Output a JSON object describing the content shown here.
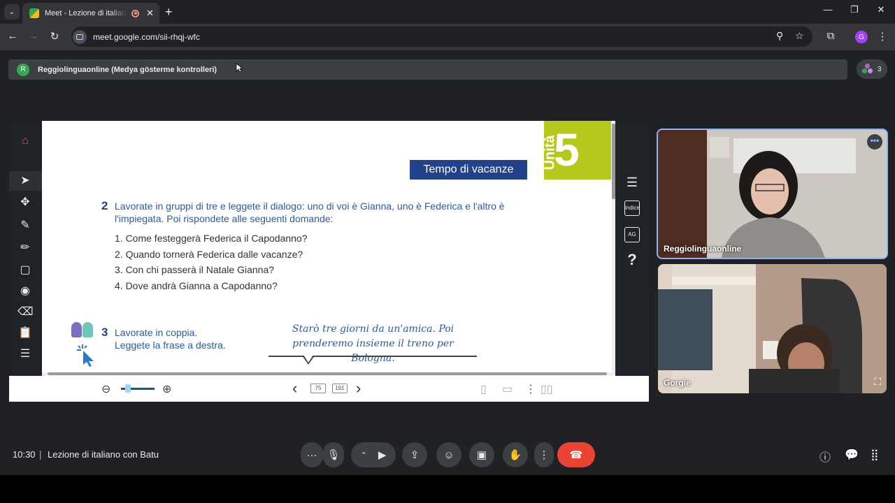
{
  "browser": {
    "tab_title": "Meet - Lezione di italiano c",
    "url": "meet.google.com/sii-rhqj-wfc",
    "profile_initial": "G"
  },
  "banner": {
    "presenter_initial": "R",
    "text": "Reggiolinguaonline (Medya gösterme kontrolleri)",
    "participants_count": "3"
  },
  "shared_page": {
    "unit_word": "Unità",
    "unit_number": "5",
    "unit_title": "Tempo di vacanze",
    "exercise2": {
      "number": "2",
      "text": "Lavorate in gruppi di tre e leggete il dialogo: uno di voi è Gianna, uno è Federica e l'altro è l'impiegata. Poi rispondete alle seguenti domande:"
    },
    "questions": [
      "1.  Come festeggerà Federica il Capodanno?",
      "2.  Quando tornerà Federica dalle vacanze?",
      "3.  Con chi passerà il Natale Gianna?",
      "4.  Dove andrà Gianna a Capodanno?"
    ],
    "exercise3": {
      "number": "3",
      "line1": "Lavorate in coppia.",
      "line2": "Leggete la frase a destra."
    },
    "handwritten": {
      "line1": "Starò tre giorni da un'amica. Poi",
      "line2": "prenderemo insieme il treno per Bologna."
    },
    "right_tools": {
      "index_label": "indice",
      "ag_label": "AG",
      "help": "?"
    },
    "bottom_bar": {
      "current_page": "75",
      "total_pages": "191",
      "zoom_level": 0.2
    }
  },
  "participants": [
    {
      "name": "Reggiolinguaonline"
    },
    {
      "name": "Gorgie"
    }
  ],
  "meeting": {
    "time": "10:30",
    "separator": "|",
    "title": "Lezione di italiano con Batu"
  },
  "colors": {
    "unit_green": "#b5c91b",
    "title_blue": "#22428e",
    "text_blue": "#2a5aa8",
    "end_call": "#ea4335",
    "active_speaker": "#8ab4f8"
  }
}
